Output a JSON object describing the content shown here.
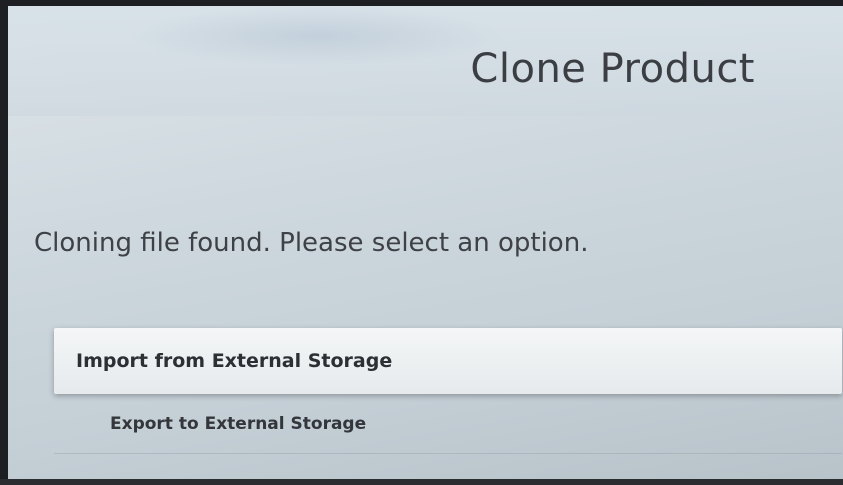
{
  "header": {
    "title": "Clone Product"
  },
  "main": {
    "message": "Cloning file found. Please select an option."
  },
  "options": [
    {
      "label": "Import from External Storage",
      "selected": true
    },
    {
      "label": "Export to External Storage",
      "selected": false
    }
  ]
}
